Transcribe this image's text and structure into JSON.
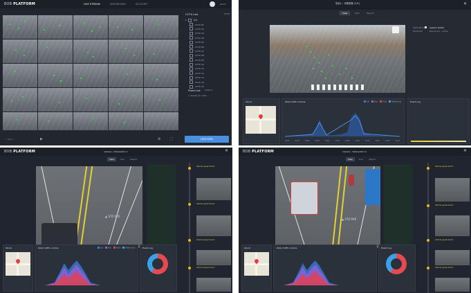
{
  "panel_tl": {
    "logo_prefix": "BOB",
    "logo_main": "PLATFORM",
    "tabs": [
      "LIVE STREAM",
      "DASHBOARD",
      "ACCOUNT"
    ],
    "user": {
      "name": "admin"
    },
    "list_title": "CCTV List",
    "list_meta": "CCTV",
    "group": "전체",
    "items": [
      "CCTV 01",
      "CCTV 02",
      "CCTV 03",
      "CCTV 04",
      "CCTV 05",
      "CCTV 06",
      "CCTV 07",
      "CCTV 08",
      "CCTV 09",
      "CCTV 10",
      "CCTV 11",
      "CCTV 12",
      "CCTV 13",
      "CCTV 14",
      "CCTV 15"
    ],
    "fixed_title": "Fixed List",
    "fixed_meta": "0 items",
    "fixed_hint": "+ display to order",
    "bottom_left": "< 1/1 >",
    "view_btn": "VIEW MORE"
  },
  "panel_tr": {
    "title": "영상1 : 교통현황 (1/1)",
    "tabs": [
      "View",
      "Grid",
      "Report"
    ],
    "side_label": "2023.01.01",
    "side_time": "00:00:00",
    "side_status": "System Notify",
    "side_detail": "Device 01 : online",
    "about": "About",
    "daily_title": "Daily traffic volume",
    "event_log": "Event Log",
    "legend": [
      "Car",
      "Bus",
      "Truck",
      "Motorcycle"
    ],
    "chart_axis": [
      "00:00",
      "02:00",
      "04:00",
      "06:00",
      "08:00",
      "10:00",
      "12:00",
      "14:00",
      "16:00",
      "18:00",
      "20:00",
      "22:00"
    ]
  },
  "panel_bl": {
    "logo_prefix": "BOB",
    "logo_main": "PLATFORM",
    "title": "camera : Intersection 1",
    "tabs": [
      "View",
      "Grid",
      "Report"
    ],
    "about": "About",
    "daily_title": "Daily traffic volume",
    "event_log": "Event Log",
    "legend": [
      "Car",
      "Bus",
      "Truck",
      "Motorcycle"
    ],
    "events": [
      "Vehicle speed Alarm",
      "Vehicle speed Alarm",
      "Vehicle speed Alarm",
      "Vehicle speed Alarm"
    ]
  },
  "panel_br": {
    "logo_prefix": "BOB",
    "logo_main": "PLATFORM",
    "title": "camera : Intersection 2",
    "tabs": [
      "View",
      "Grid",
      "Report"
    ],
    "about": "About",
    "daily_title": "Daily traffic volume",
    "event_log": "Event Log",
    "events": [
      "Vehicle speed Alarm",
      "Vehicle speed Alarm",
      "Vehicle speed Alarm",
      "Vehicle speed Alarm"
    ]
  },
  "colors": {
    "panel_bg": "#22272f",
    "accent_blue": "#4a90e2",
    "detect_green": "#3bd34b",
    "alarm_yellow": "#f1b40d",
    "chart_blue": "#3a7bd5",
    "chart_red": "#d9435a",
    "chart_purple": "#8d5fd3",
    "donut_red": "#e64950",
    "donut_blue": "#3aa0e8"
  }
}
